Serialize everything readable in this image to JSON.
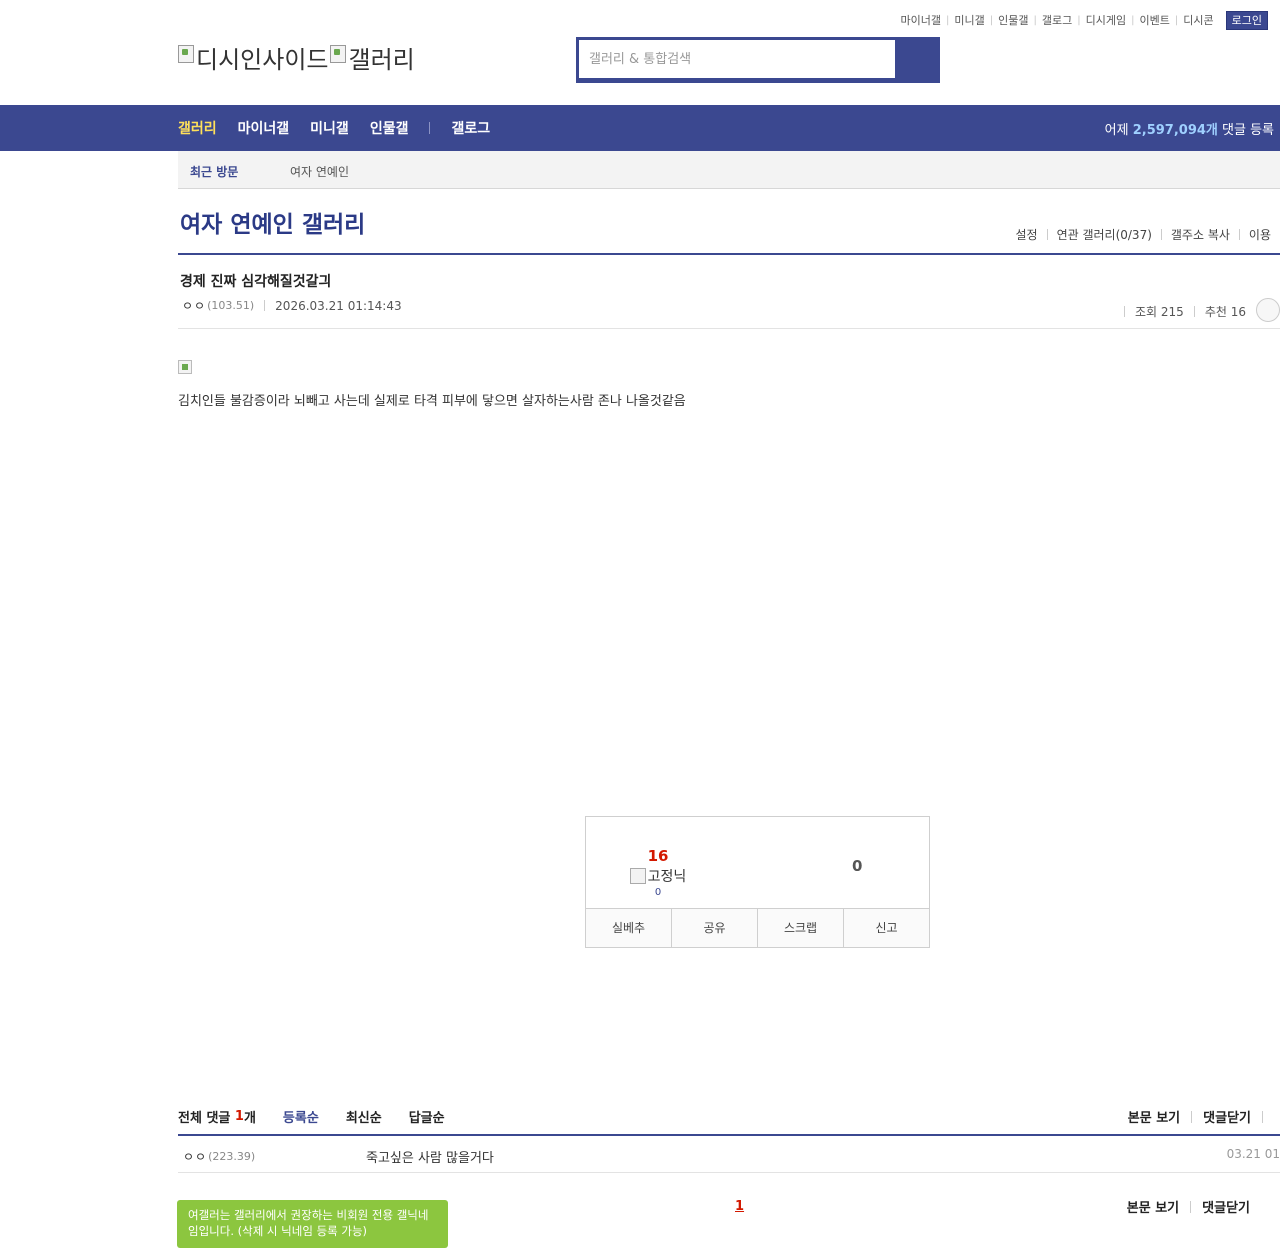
{
  "top_links": [
    "마이너갤",
    "미니갤",
    "인물갤",
    "갤로그",
    "디시게임",
    "이벤트",
    "디시콘"
  ],
  "login_label": "로그인",
  "logo": {
    "alt_main": "디시인사이드",
    "alt_gallery": "갤러리"
  },
  "search": {
    "placeholder": "갤러리 & 통합검색",
    "value": ""
  },
  "gnb": {
    "items": [
      "갤러리",
      "마이너갤",
      "미니갤",
      "인물갤"
    ],
    "extra": "갤로그",
    "stat_prefix": "어제",
    "stat_count": "2,597,094개",
    "stat_suffix": "댓글 등록"
  },
  "recent": {
    "label": "최근 방문",
    "item": "여자 연예인"
  },
  "gallery": {
    "title": "여자 연예인 갤러리",
    "links": [
      "설정",
      "연관 갤러리(0/37)",
      "갤주소 복사",
      "이용"
    ]
  },
  "post": {
    "title": "경제 진짜 심각해질것갈긔",
    "nick": "ㅇㅇ",
    "ip": "(103.51)",
    "date": "2026.03.21 01:14:43",
    "views_label": "조회 215",
    "recommend_label": "추천 16",
    "body": "김치인들 불감증이라 뇌빼고 사는데 실제로 타격 피부에 닿으면 살자하는사람 존나 나올것같음"
  },
  "recommend": {
    "up_count": "16",
    "fixed_label": "고정닉",
    "fixed_count": "0",
    "down_count": "0",
    "buttons": [
      "실베추",
      "공유",
      "스크랩",
      "신고"
    ]
  },
  "comments": {
    "total_label": "전체 댓글",
    "total_count": "1",
    "total_unit": "개",
    "sort": [
      "등록순",
      "최신순",
      "답글순"
    ],
    "view_post": "본문 보기",
    "close": "댓글닫기",
    "list": [
      {
        "nick": "ㅇㅇ",
        "ip": "(223.39)",
        "text": "죽고싶은 사람 많을거다",
        "date": "03.21 01"
      }
    ],
    "page": "1"
  },
  "tip": "여갤러는 갤러리에서 권장하는 비회원 전용 갤닉네임입니다. (삭제 시 닉네임 등록 가능)"
}
